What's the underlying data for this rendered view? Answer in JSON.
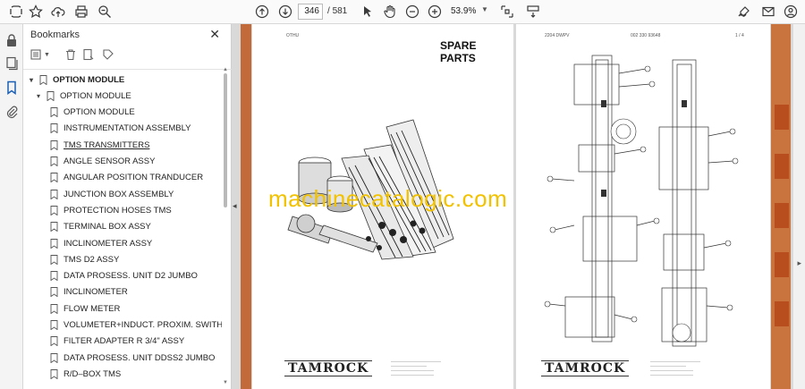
{
  "toolbar": {
    "current_page": "346",
    "page_separator": "/",
    "total_pages": "581",
    "zoom": "53.9%"
  },
  "bookmarks": {
    "title": "Bookmarks",
    "items": [
      {
        "label": "OPTION MODULE",
        "level": 0,
        "expanded": true
      },
      {
        "label": "OPTION MODULE",
        "level": 1,
        "expanded": true
      },
      {
        "label": "OPTION MODULE",
        "level": 2
      },
      {
        "label": "INSTRUMENTATION ASSEMBLY",
        "level": 2
      },
      {
        "label": "TMS TRANSMITTERS",
        "level": 2,
        "hover": true
      },
      {
        "label": "ANGLE SENSOR ASSY",
        "level": 2
      },
      {
        "label": "ANGULAR POSITION TRANDUCER",
        "level": 2
      },
      {
        "label": "JUNCTION BOX ASSEMBLY",
        "level": 2
      },
      {
        "label": "PROTECTION HOSES TMS",
        "level": 2
      },
      {
        "label": "TERMINAL BOX ASSY",
        "level": 2
      },
      {
        "label": "INCLINOMETER ASSY",
        "level": 2
      },
      {
        "label": "TMS D2 ASSY",
        "level": 2
      },
      {
        "label": "DATA PROSESS. UNIT D2 JUMBO",
        "level": 2
      },
      {
        "label": "INCLINOMETER",
        "level": 2
      },
      {
        "label": "FLOW METER",
        "level": 2
      },
      {
        "label": "VOLUMETER+INDUCT. PROXIM. SWITHS",
        "level": 2
      },
      {
        "label": "FILTER ADAPTER R 3/4\" ASSY",
        "level": 2
      },
      {
        "label": "DATA PROSESS. UNIT DDSS2 JUMBO",
        "level": 2
      },
      {
        "label": "R/D–BOX TMS",
        "level": 2
      }
    ]
  },
  "document": {
    "left_page": {
      "title": "SPARE PARTS",
      "header_small": "OTHU",
      "footer_logo": "TAMROCK"
    },
    "right_page": {
      "header_left": "2204 DWPV",
      "header_mid": "002 330 93648",
      "header_right": "1 / 4",
      "footer_logo": "TAMROCK"
    },
    "watermark": "machinecatalogic.com"
  },
  "colors": {
    "accent": "#1a5fb4",
    "page_strip": "#c36a3a",
    "watermark": "#f2c200"
  }
}
